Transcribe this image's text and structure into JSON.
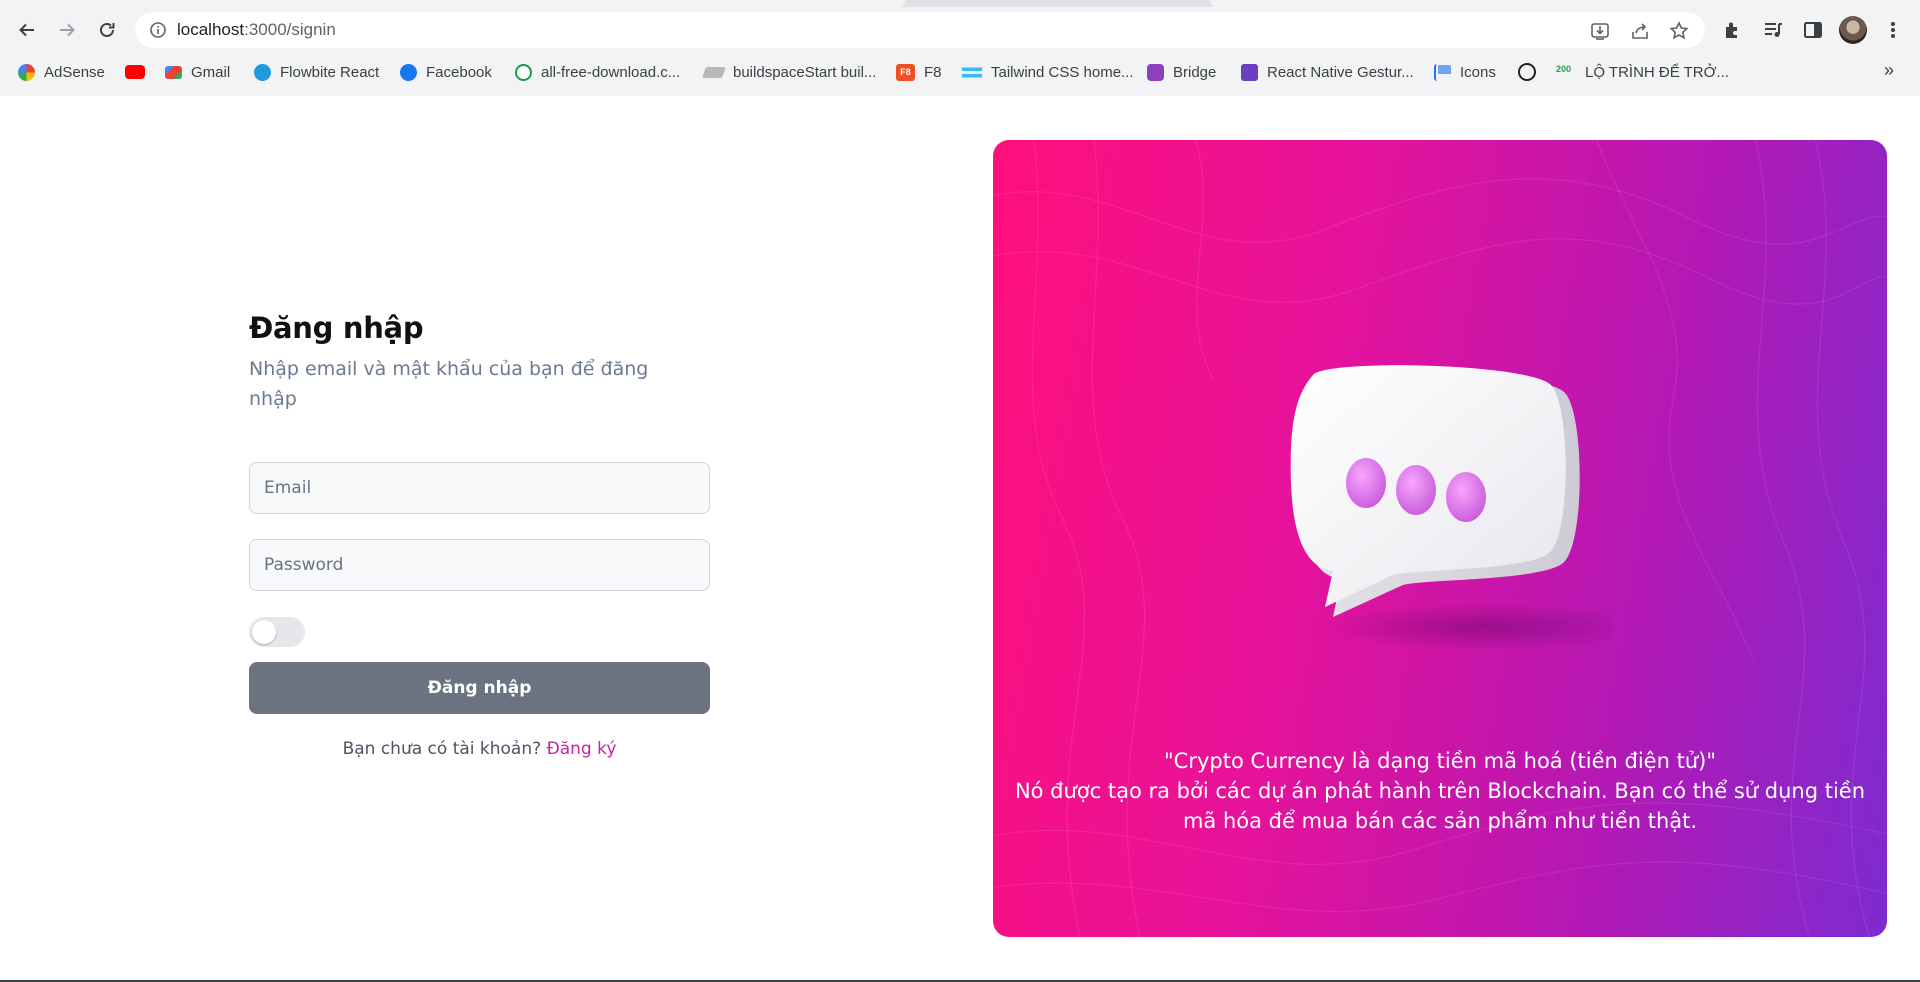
{
  "browser": {
    "url_host": "localhost",
    "url_path": ":3000/signin",
    "bookmarks": [
      {
        "label": "AdSense",
        "icon": "google-icon"
      },
      {
        "label": "",
        "icon": "youtube-icon"
      },
      {
        "label": "Gmail",
        "icon": "gmail-icon"
      },
      {
        "label": "Flowbite React",
        "icon": "flowbite-icon"
      },
      {
        "label": "Facebook",
        "icon": "facebook-icon"
      },
      {
        "label": "all-free-download.c...",
        "icon": "download-icon"
      },
      {
        "label": "buildspaceStart buil...",
        "icon": "buildspace-icon"
      },
      {
        "label": "F8",
        "icon": "f8-icon"
      },
      {
        "label": "Tailwind CSS home...",
        "icon": "tailwind-icon"
      },
      {
        "label": "Bridge",
        "icon": "bridge-icon"
      },
      {
        "label": "React Native Gestur...",
        "icon": "rocket-icon"
      },
      {
        "label": "Icons",
        "icon": "flag-icon"
      },
      {
        "label": "",
        "icon": "compass-icon"
      },
      {
        "label": "LỘ TRÌNH ĐỂ TRỞ...",
        "icon": "200-icon"
      }
    ],
    "bookmarks_more": "»",
    "f8_label": "F8",
    "badge_200": "200"
  },
  "login": {
    "title": "Đăng nhập",
    "subtitle": "Nhập email và mật khẩu của bạn để đăng nhập",
    "email_placeholder": "Email",
    "password_placeholder": "Password",
    "submit_label": "Đăng nhập",
    "no_account_text": "Bạn chưa có tài khoản?",
    "signup_link": "Đăng ký"
  },
  "hero": {
    "quote_line1": "\"Crypto Currency là dạng tiền mã hoá (tiền điện tử)\"",
    "quote_line2": "Nó được tạo ra bởi các dự án phát hành trên Blockchain. Bạn có thể sử dụng tiền mã hóa để mua bán các sản phẩm như tiền thật."
  },
  "colors": {
    "gradient_start": "#ff0f7b",
    "gradient_end": "#7d2bd0",
    "signup_link": "#c026a3",
    "button": "#6b7280"
  }
}
